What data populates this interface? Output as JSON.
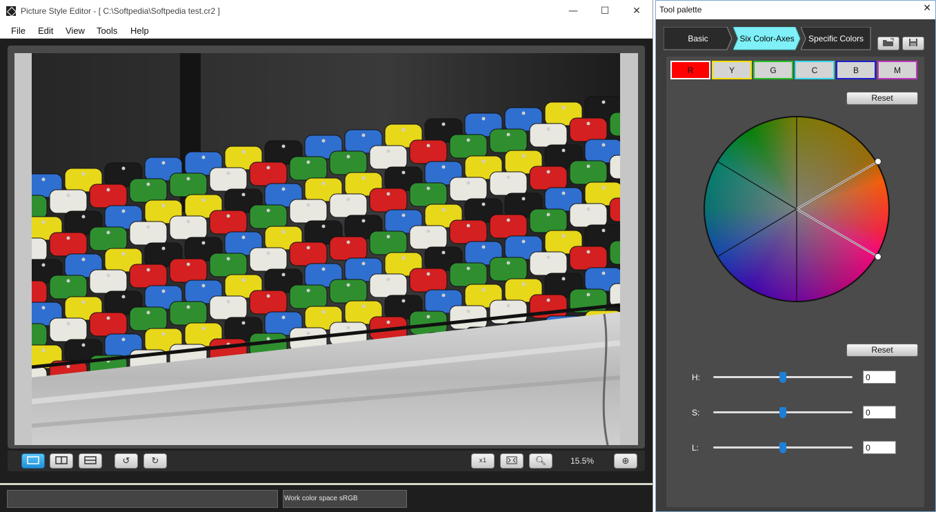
{
  "main_window": {
    "title": "Picture Style Editor - [ C:\\Softpedia\\Softpedia test.cr2 ]",
    "controls": {
      "minimize": "—",
      "maximize": "☐",
      "close": "✕"
    }
  },
  "menu": {
    "items": [
      "File",
      "Edit",
      "View",
      "Tools",
      "Help"
    ]
  },
  "viewer": {
    "image_subject": "stadium-seats-photo",
    "zoom": "15.5%",
    "toolbar_icons": [
      "single-view-icon",
      "split-view-icon",
      "split-horizontal-icon",
      "rotate-left-icon",
      "rotate-right-icon",
      "actual-size-icon",
      "fit-screen-icon",
      "zoom-out-icon",
      "zoom-in-icon"
    ],
    "actual_size_label": "x1"
  },
  "status": {
    "left_text": "",
    "color_space": "Work color space  sRGB"
  },
  "palette": {
    "title": "Tool palette",
    "close": "✕",
    "tabs": [
      {
        "label": "Basic",
        "active": false
      },
      {
        "label": "Six Color-Axes",
        "active": true
      },
      {
        "label": "Specific Colors",
        "active": false
      }
    ],
    "colors": {
      "active_tab": "#7ff0f8",
      "tab_bg": "#2a2a2a",
      "panel_bg": "#4b4b4b"
    },
    "axes": [
      {
        "label": "R",
        "fill": "#ff0000",
        "border": "#ffffff",
        "selected": true
      },
      {
        "label": "Y",
        "fill": "#d4d4d4",
        "border": "#f4e000"
      },
      {
        "label": "G",
        "fill": "#d4d4d4",
        "border": "#22c022"
      },
      {
        "label": "C",
        "fill": "#d4d4d4",
        "border": "#39d8e8"
      },
      {
        "label": "B",
        "fill": "#d4d4d4",
        "border": "#1f1fcf"
      },
      {
        "label": "M",
        "fill": "#d4d4d4",
        "border": "#c238c2"
      }
    ],
    "reset_top": "Reset",
    "reset_bottom": "Reset",
    "sliders": [
      {
        "label": "H:",
        "value": "0",
        "position": 0.5
      },
      {
        "label": "S:",
        "value": "0",
        "position": 0.5
      },
      {
        "label": "L:",
        "value": "0",
        "position": 0.5
      }
    ]
  }
}
